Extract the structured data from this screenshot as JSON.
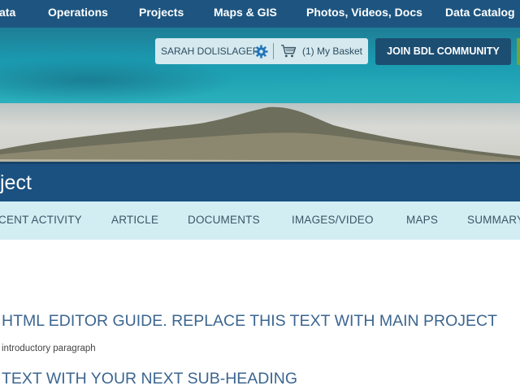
{
  "top_nav": {
    "items": [
      "ata",
      "Operations",
      "Projects",
      "Maps & GIS",
      "Photos, Videos, Docs",
      "Data Catalog"
    ]
  },
  "header": {
    "user_name": "SARAH DOLISLAGER",
    "basket_label": "(1) My Basket",
    "join_button": "JOIN BDL COMMUNITY"
  },
  "page": {
    "title": "ject"
  },
  "tabs": [
    "CENT ACTIVITY",
    "ARTICLE",
    "DOCUMENTS",
    "IMAGES/VIDEO",
    "MAPS",
    "SUMMARY"
  ],
  "content": {
    "heading": "HTML EDITOR GUIDE. REPLACE THIS TEXT WITH MAIN PROJECT",
    "paragraph": " introductory paragraph",
    "subheading": "TEXT WITH YOUR NEXT SUB-HEADING"
  },
  "colors": {
    "nav_bg": "#1d5580",
    "title_bar_bg": "#1b5180",
    "tab_bar_bg": "#d2eef3",
    "join_button_bg": "#1c4e72",
    "heading_text": "#3c6690"
  },
  "icons": [
    "gear-icon",
    "cart-icon"
  ]
}
